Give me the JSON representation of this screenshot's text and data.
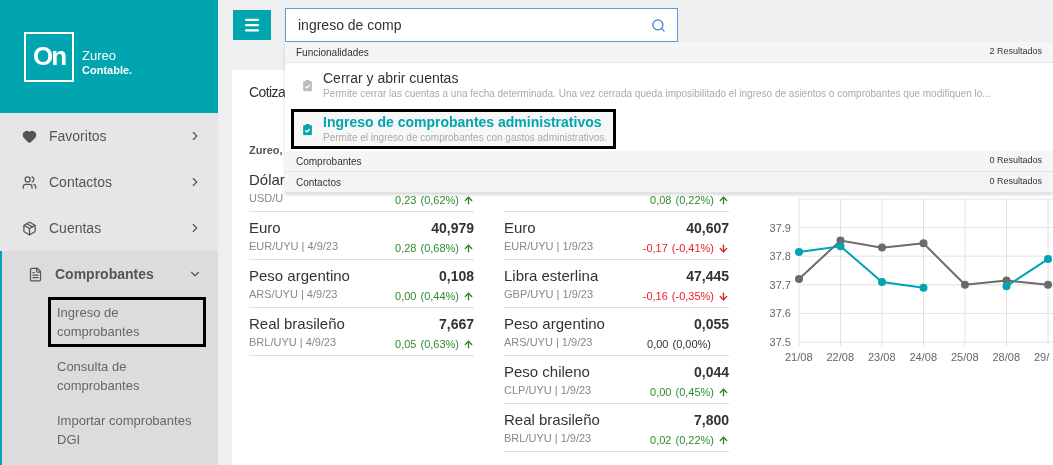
{
  "logo": {
    "mark": "On",
    "name": "Zureo",
    "product": "Contable."
  },
  "sidebar": {
    "items": [
      {
        "label": "Favoritos",
        "expanded": false
      },
      {
        "label": "Contactos",
        "expanded": false
      },
      {
        "label": "Cuentas",
        "expanded": false
      },
      {
        "label": "Comprobantes",
        "expanded": true,
        "children": [
          {
            "label": "Ingreso de comprobantes",
            "outlined": true
          },
          {
            "label": "Consulta de comprobantes",
            "outlined": false
          },
          {
            "label": "Importar comprobantes DGI",
            "outlined": false
          }
        ]
      }
    ]
  },
  "search": {
    "value": "ingreso de comp"
  },
  "results": [
    {
      "section": "Funcionalidades",
      "count": "2 Resultados",
      "items": [
        {
          "title": "Cerrar y abrir cuentas",
          "description": "Permite cerrar las cuentas a una fecha determinada. Una vez cerrada queda imposibilitado el ingreso de asientos o comprobantes que modifiquen lo...",
          "selected": false,
          "outlined": false
        },
        {
          "title": "Ingreso de comprobantes administrativos",
          "description": "Permite el ingreso de comprobantes con gastos administrativos.",
          "selected": true,
          "outlined": true
        }
      ]
    },
    {
      "section": "Comprobantes",
      "count": "0 Resultados"
    },
    {
      "section": "Contactos",
      "count": "0 Resultados"
    }
  ],
  "card": {
    "title": "Cotiza",
    "columns": [
      {
        "header": "Zureo,",
        "rows": [
          {
            "name": "Dólar",
            "code": "USD/U",
            "change": "0,23",
            "percent": "(0,62%)",
            "kind": "up"
          },
          {
            "name": "Euro",
            "code": "EUR/UYU | 4/9/23",
            "value": "40,979",
            "change": "0,28",
            "percent": "(0,68%)",
            "kind": "up"
          },
          {
            "name": "Peso argentino",
            "code": "ARS/UYU | 4/9/23",
            "value": "0,108",
            "change": "0,00",
            "percent": "(0,44%)",
            "kind": "up"
          },
          {
            "name": "Real brasileño",
            "code": "BRL/UYU | 4/9/23",
            "value": "7,667",
            "change": "0,05",
            "percent": "(0,63%)",
            "kind": "up"
          }
        ]
      },
      {
        "rows": [
          {
            "change": "0,08",
            "percent": "(0,22%)",
            "kind": "up"
          },
          {
            "name": "Euro",
            "code": "EUR/UYU | 1/9/23",
            "value": "40,607",
            "change": "-0,17",
            "percent": "(-0,41%)",
            "kind": "down"
          },
          {
            "name": "Libra esterlina",
            "code": "GBP/UYU | 1/9/23",
            "value": "47,445",
            "change": "-0,16",
            "percent": "(-0,35%)",
            "kind": "down"
          },
          {
            "name": "Peso argentino",
            "code": "ARS/UYU | 1/9/23",
            "value": "0,055",
            "change": "0,00",
            "percent": "(0,00%)",
            "kind": "flat"
          },
          {
            "name": "Peso chileno",
            "code": "CLP/UYU | 1/9/23",
            "value": "0,044",
            "change": "0,00",
            "percent": "(0,45%)",
            "kind": "up"
          },
          {
            "name": "Real brasileño",
            "code": "BRL/UYU | 1/9/23",
            "value": "7,800",
            "change": "0,02",
            "percent": "(0,22%)",
            "kind": "up"
          }
        ]
      }
    ],
    "chart_data": {
      "type": "line",
      "grid": true,
      "categories": [
        "21/08",
        "22/08",
        "23/08",
        "24/08",
        "25/08",
        "28/08",
        "29/"
      ],
      "series": [
        {
          "color": "#6b6b6b",
          "marker": true,
          "values": [
            37.72,
            37.855,
            37.83,
            37.845,
            37.7,
            37.715,
            37.7
          ]
        },
        {
          "color": "#00a5b0",
          "marker": true,
          "values": [
            37.815,
            37.835,
            37.71,
            37.69,
            null,
            37.695,
            37.79
          ]
        }
      ],
      "ylim": [
        37.5,
        38.0
      ],
      "yticks": [
        {
          "value": 37.5,
          "label": "37.5"
        },
        {
          "value": 37.6,
          "label": "37.6"
        },
        {
          "value": 37.7,
          "label": "37.7"
        },
        {
          "value": 37.8,
          "label": "37.8"
        },
        {
          "value": 37.9,
          "label": "37.9"
        }
      ]
    }
  }
}
